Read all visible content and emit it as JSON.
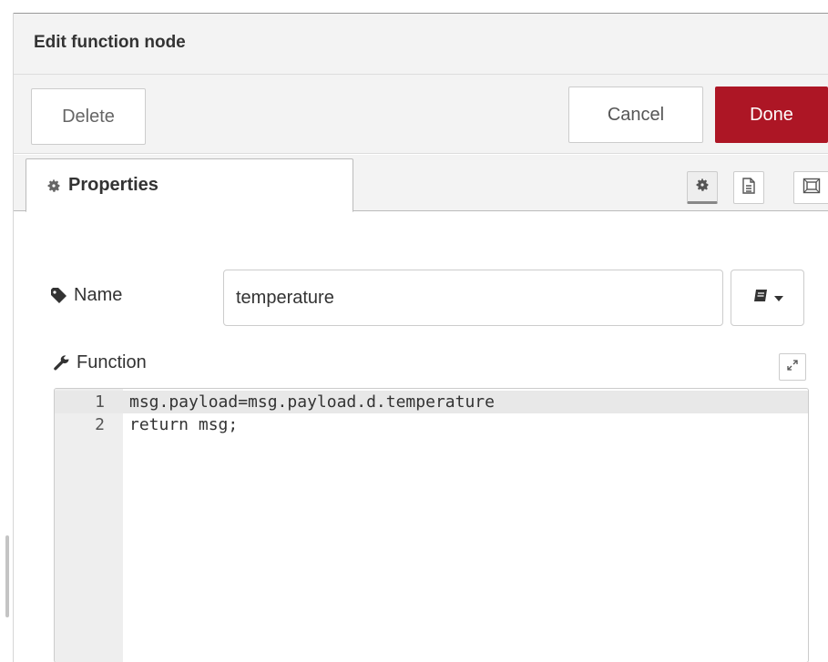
{
  "tray": {
    "title": "Edit function node",
    "delete_label": "Delete",
    "cancel_label": "Cancel",
    "done_label": "Done"
  },
  "tabs": {
    "properties_label": "Properties",
    "actions": [
      "gear-icon",
      "description-icon",
      "appearance-icon"
    ]
  },
  "form": {
    "name_label": "Name",
    "name_value": "temperature",
    "function_label": "Function"
  },
  "editor": {
    "lines": [
      {
        "num": "1",
        "code": "msg.payload=msg.payload.d.temperature"
      },
      {
        "num": "2",
        "code": "return msg;"
      }
    ]
  },
  "colors": {
    "done_button": "#ad1625",
    "tray_background": "#f3f3f3",
    "gutter": "#eeeeee"
  }
}
